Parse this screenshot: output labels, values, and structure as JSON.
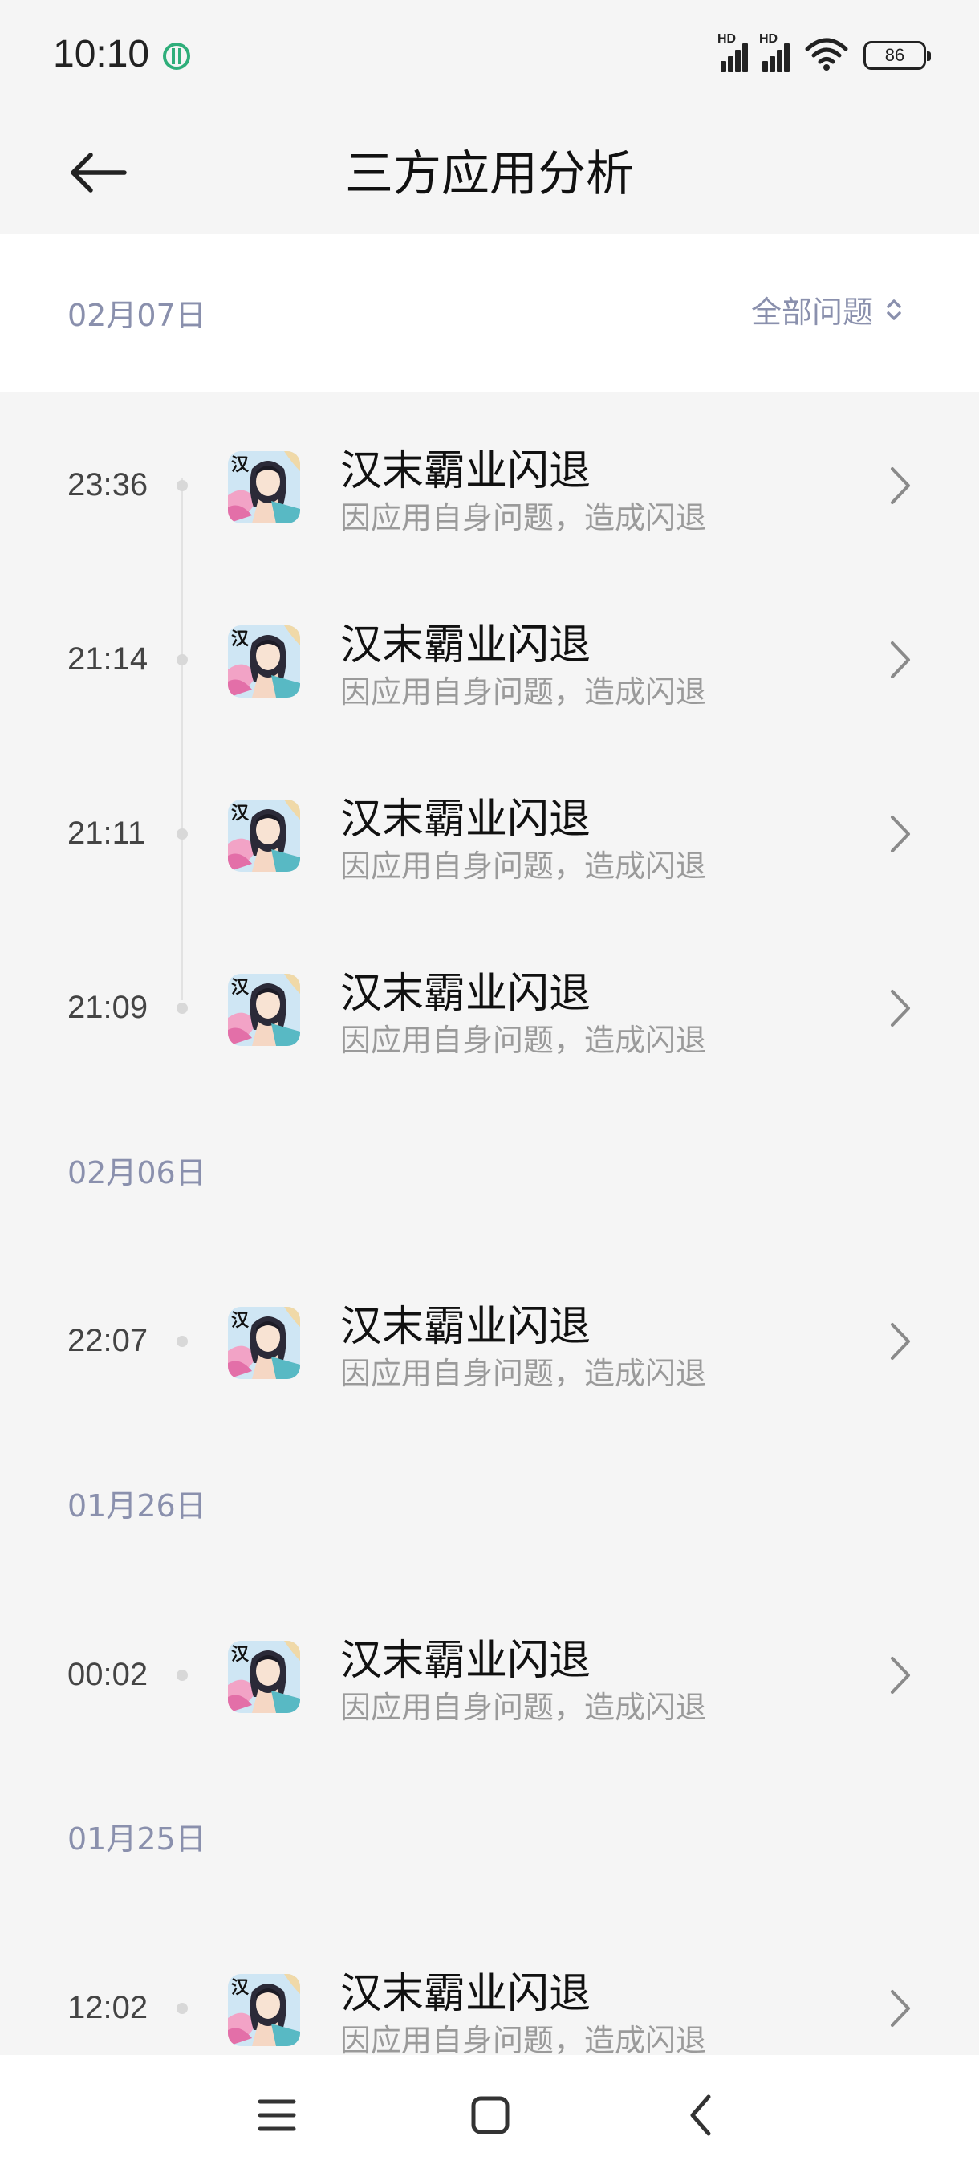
{
  "status_bar": {
    "time": "10:10",
    "signal_label_1": "HD",
    "signal_label_2": "HD",
    "battery": "86"
  },
  "header": {
    "title": "三方应用分析"
  },
  "filter": {
    "first_date": "02月07日",
    "label": "全部问题"
  },
  "sections": [
    {
      "date": "02月07日",
      "items": [
        {
          "time": "23:36",
          "title": "汉末霸业闪退",
          "subtitle": "因应用自身问题，造成闪退"
        },
        {
          "time": "21:14",
          "title": "汉末霸业闪退",
          "subtitle": "因应用自身问题，造成闪退"
        },
        {
          "time": "21:11",
          "title": "汉末霸业闪退",
          "subtitle": "因应用自身问题，造成闪退"
        },
        {
          "time": "21:09",
          "title": "汉末霸业闪退",
          "subtitle": "因应用自身问题，造成闪退"
        }
      ]
    },
    {
      "date": "02月06日",
      "items": [
        {
          "time": "22:07",
          "title": "汉末霸业闪退",
          "subtitle": "因应用自身问题，造成闪退"
        }
      ]
    },
    {
      "date": "01月26日",
      "items": [
        {
          "time": "00:02",
          "title": "汉末霸业闪退",
          "subtitle": "因应用自身问题，造成闪退"
        }
      ]
    },
    {
      "date": "01月25日",
      "items": [
        {
          "time": "12:02",
          "title": "汉末霸业闪退",
          "subtitle": "因应用自身问题，造成闪退"
        }
      ]
    }
  ],
  "icons": {
    "back": "arrow-left-icon",
    "filter": "sort-updown-icon",
    "row_chevron": "chevron-right-icon",
    "nav_menu": "menu-icon",
    "nav_home": "home-square-icon",
    "nav_back": "chevron-left-icon"
  },
  "colors": {
    "accent_date": "#8a90ad",
    "background": "#f5f5f5"
  }
}
